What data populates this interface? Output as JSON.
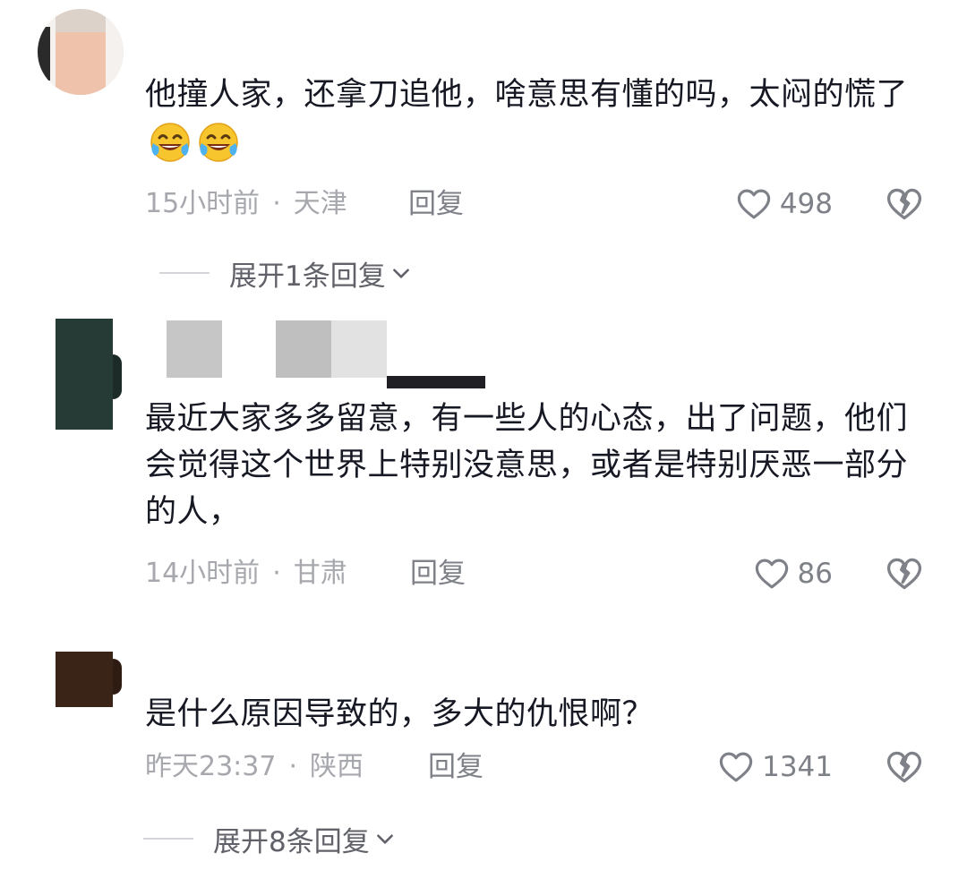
{
  "comments": [
    {
      "text": "他撞人家，还拿刀追他，啥意思有懂的吗，太闷的慌了",
      "emoji": [
        "laughing-crying-icon",
        "laughing-crying-icon"
      ],
      "time": "15小时前",
      "location": "天津",
      "reply_label": "回复",
      "likes": "498",
      "expand_label": "展开1条回复"
    },
    {
      "text": "最近大家多多留意，有一些人的心态，出了问题，他们会觉得这个世界上特别没意思，或者是特别厌恶一部分的人，",
      "time": "14小时前",
      "location": "甘肃",
      "reply_label": "回复",
      "likes": "86"
    },
    {
      "text": "是什么原因导致的，多大的仇恨啊？",
      "time": "昨天23:37",
      "location": "陕西",
      "reply_label": "回复",
      "likes": "1341",
      "expand_label": "展开8条回复"
    }
  ],
  "separator": "·",
  "colors": {
    "text": "#161823",
    "meta": "#a6a8ae",
    "action": "#7f8188"
  }
}
